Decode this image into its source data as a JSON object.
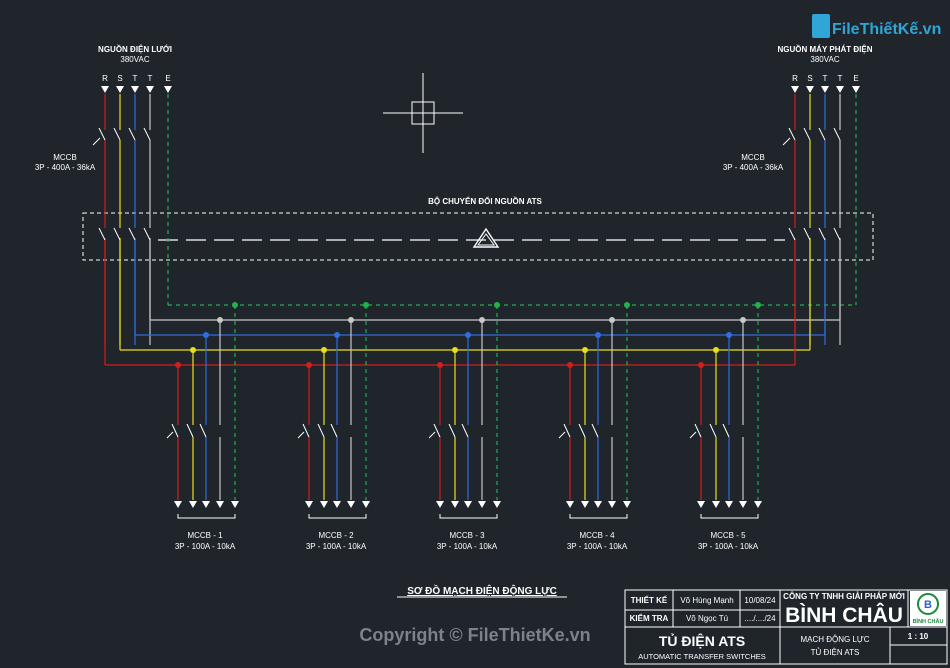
{
  "colors": {
    "background": "#1f252b",
    "phase_r": "#d21e1e",
    "phase_s": "#e8e01c",
    "phase_t1": "#2f6ee0",
    "phase_t2": "#c8c8c8",
    "earth": "#22b14c",
    "white": "#ffffff"
  },
  "watermark": {
    "logo_text": "FileThiếtKế.vn",
    "copyright": "Copyright © FileThietKe.vn"
  },
  "source_left": {
    "title": "NGUỒN ĐIỆN LƯỚI",
    "voltage": "380VAC",
    "breaker_name": "MCCB",
    "breaker_spec": "3P - 400A - 36kA"
  },
  "source_right": {
    "title": "NGUỒN MÁY PHÁT ĐIỆN",
    "voltage": "380VAC",
    "breaker_name": "MCCB",
    "breaker_spec": "3P - 400A - 36kA"
  },
  "phase_labels": [
    "R",
    "S",
    "T",
    "T",
    "E"
  ],
  "ats_label": "BỘ CHUYỂN ĐỔI NGUỒN ATS",
  "outgoing": [
    {
      "name": "MCCB - 1",
      "spec": "3P - 100A - 10kA"
    },
    {
      "name": "MCCB - 2",
      "spec": "3P - 100A - 10kA"
    },
    {
      "name": "MCCB - 3",
      "spec": "3P - 100A - 10kA"
    },
    {
      "name": "MCCB - 4",
      "spec": "3P - 100A - 10kA"
    },
    {
      "name": "MCCB - 5",
      "spec": "3P - 100A - 10kA"
    }
  ],
  "diagram_title": "SƠ ĐỒ MẠCH ĐIỆN ĐỘNG LỰC",
  "title_block": {
    "designer_label": "THIẾT KẾ",
    "designer_name": "Võ Hùng Mạnh",
    "designer_date": "10/08/24",
    "checker_label": "KIỂM TRA",
    "checker_name": "Võ Ngọc Tú",
    "checker_date": "..../..../24",
    "company_line": "CÔNG TY TNHH GIẢI PHÁP MỚI",
    "company_name": "BÌNH CHÂU",
    "logo_caption": "BÌNH CHÂU",
    "project_title": "TỦ ĐIỆN ATS",
    "project_subtitle": "AUTOMATIC TRANSFER SWITCHES",
    "drawing_line1": "MẠCH ĐỘNG LỰC",
    "drawing_line2": "TỦ ĐIỆN ATS",
    "scale": "1 : 10"
  }
}
